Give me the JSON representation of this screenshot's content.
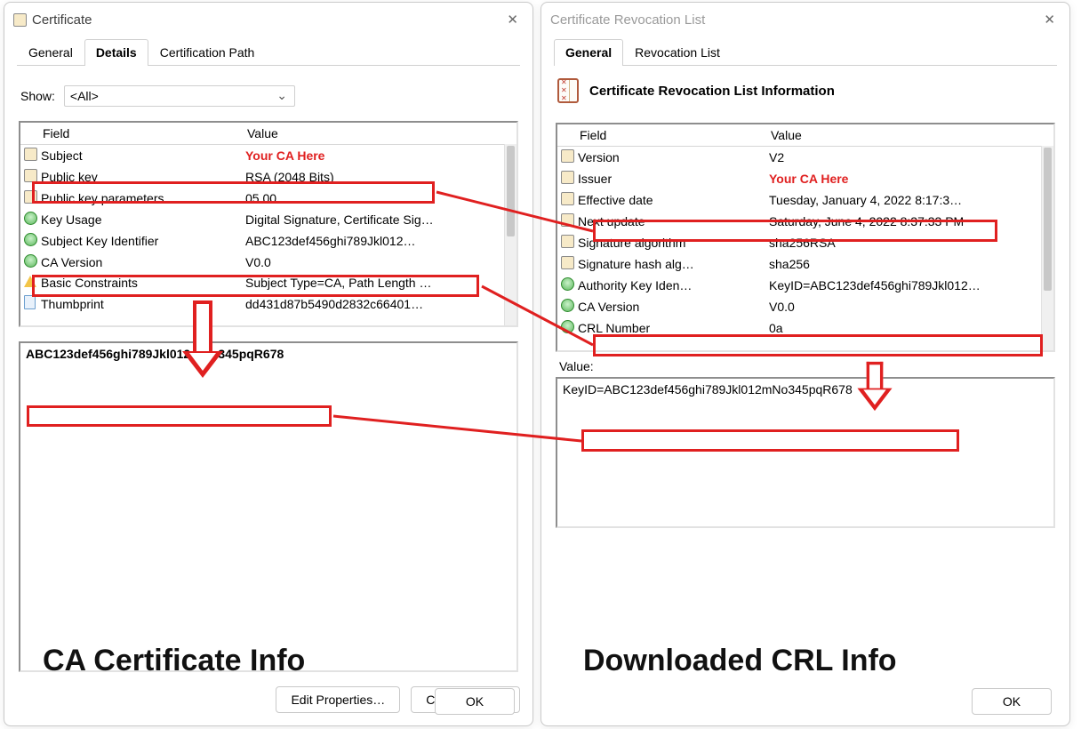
{
  "left": {
    "title": "Certificate",
    "tabs": [
      "General",
      "Details",
      "Certification Path"
    ],
    "active_tab_index": 1,
    "show_label": "Show:",
    "show_value": "<All>",
    "headers": {
      "field": "Field",
      "value": "Value"
    },
    "rows": [
      {
        "icon": "sq",
        "field": "Subject",
        "value": "Your CA Here",
        "value_red": true
      },
      {
        "icon": "sq",
        "field": "Public key",
        "value": "RSA (2048 Bits)"
      },
      {
        "icon": "sq",
        "field": "Public key parameters",
        "value": "05 00"
      },
      {
        "icon": "green",
        "field": "Key Usage",
        "value": "Digital Signature, Certificate Sig…"
      },
      {
        "icon": "green",
        "field": "Subject Key Identifier",
        "value": "ABC123def456ghi789Jkl012…"
      },
      {
        "icon": "green",
        "field": "CA Version",
        "value": "V0.0"
      },
      {
        "icon": "warn",
        "field": "Basic Constraints",
        "value": "Subject Type=CA, Path Length …"
      },
      {
        "icon": "doc",
        "field": "Thumbprint",
        "value": "dd431d87b5490d2832c66401…"
      }
    ],
    "detail_value": "ABC123def456ghi789Jkl012mNo345pqR678",
    "buttons": {
      "edit": "Edit Properties…",
      "copy": "Copy to File…"
    },
    "caption": "CA Certificate Info"
  },
  "right": {
    "title": "Certificate Revocation List",
    "tabs": [
      "General",
      "Revocation List"
    ],
    "active_tab_index": 0,
    "info_title": "Certificate Revocation List Information",
    "headers": {
      "field": "Field",
      "value": "Value"
    },
    "rows": [
      {
        "icon": "sq",
        "field": "Version",
        "value": "V2"
      },
      {
        "icon": "sq",
        "field": "Issuer",
        "value": "Your CA Here",
        "value_red": true
      },
      {
        "icon": "sq",
        "field": "Effective date",
        "value": "Tuesday, January 4, 2022 8:17:3…"
      },
      {
        "icon": "sq",
        "field": "Next update",
        "value": "Saturday, June 4, 2022 8:37:33 PM"
      },
      {
        "icon": "sq",
        "field": "Signature algorithm",
        "value": "sha256RSA"
      },
      {
        "icon": "sq",
        "field": "Signature hash alg…",
        "value": "sha256"
      },
      {
        "icon": "green",
        "field": "Authority Key Iden…",
        "value": "KeyID=ABC123def456ghi789Jkl012…"
      },
      {
        "icon": "green",
        "field": "CA Version",
        "value": "V0.0"
      },
      {
        "icon": "green",
        "field": "CRL Number",
        "value": "0a"
      }
    ],
    "value_label": "Value:",
    "detail_value": "KeyID=ABC123def456ghi789Jkl012mNo345pqR678",
    "caption": "Downloaded CRL Info"
  },
  "ok_label": "OK",
  "annotation_color": "#e02020"
}
